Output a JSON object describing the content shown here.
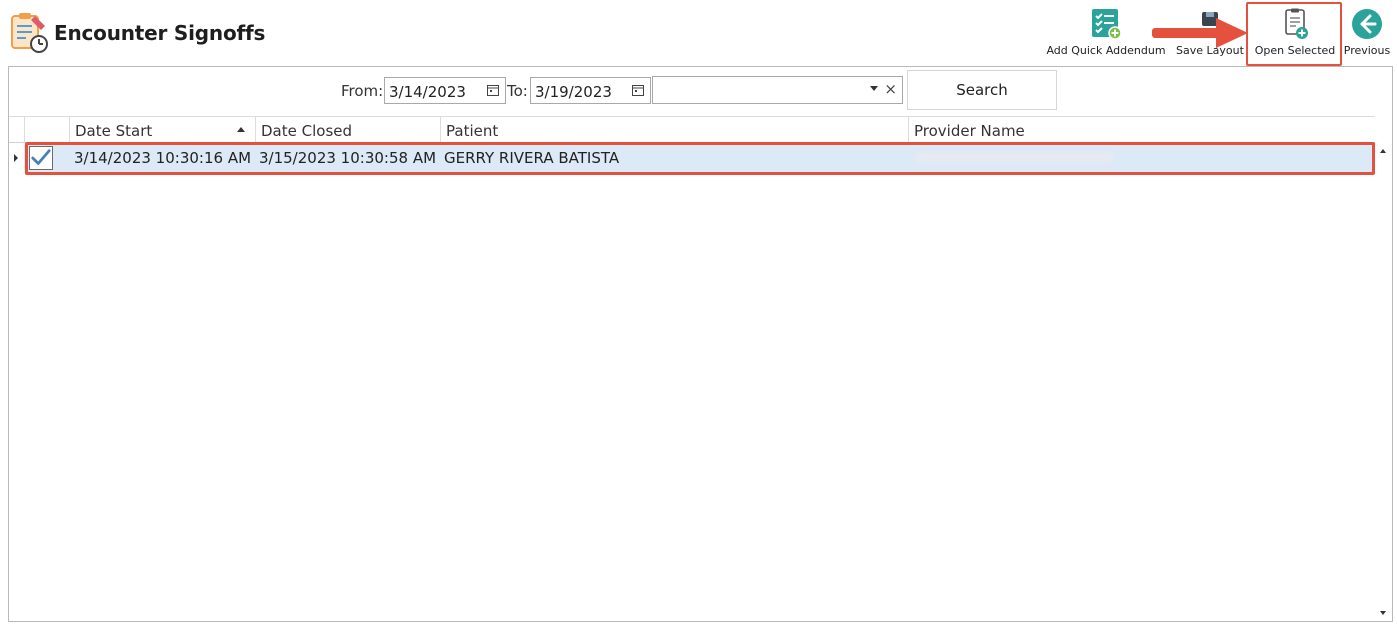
{
  "header": {
    "title": "Encounter Signoffs",
    "app_icon": "clipboard-clock-icon"
  },
  "toolbar": {
    "add_quick_addendum": {
      "label": "Add Quick Addendum",
      "icon": "checklist-add-icon"
    },
    "save_layout": {
      "label": "Save Layout",
      "icon": "save-disk-icon"
    },
    "open_selected": {
      "label": "Open Selected",
      "icon": "document-add-icon"
    },
    "previous": {
      "label": "Previous",
      "icon": "back-arrow-circle-icon"
    }
  },
  "filters": {
    "from_label": "From:",
    "from_value": "3/14/2023",
    "to_label": "To:",
    "to_value": "3/19/2023",
    "provider_value": "",
    "search_label": "Search"
  },
  "grid": {
    "columns": [
      "Date Start",
      "Date Closed",
      "Patient",
      "Provider Name"
    ],
    "sort_column": "Date Start",
    "sort_direction": "ascending",
    "rows": [
      {
        "selected": true,
        "checked": true,
        "date_start": "3/14/2023 10:30:16 AM",
        "date_closed": "3/15/2023 10:30:58 AM",
        "patient": "GERRY RIVERA BATISTA",
        "provider_name_redacted": true
      }
    ]
  },
  "colors": {
    "highlight_annotation": "#e4523f",
    "selected_row": "#dce9f7",
    "accent_teal": "#2aa39a"
  }
}
